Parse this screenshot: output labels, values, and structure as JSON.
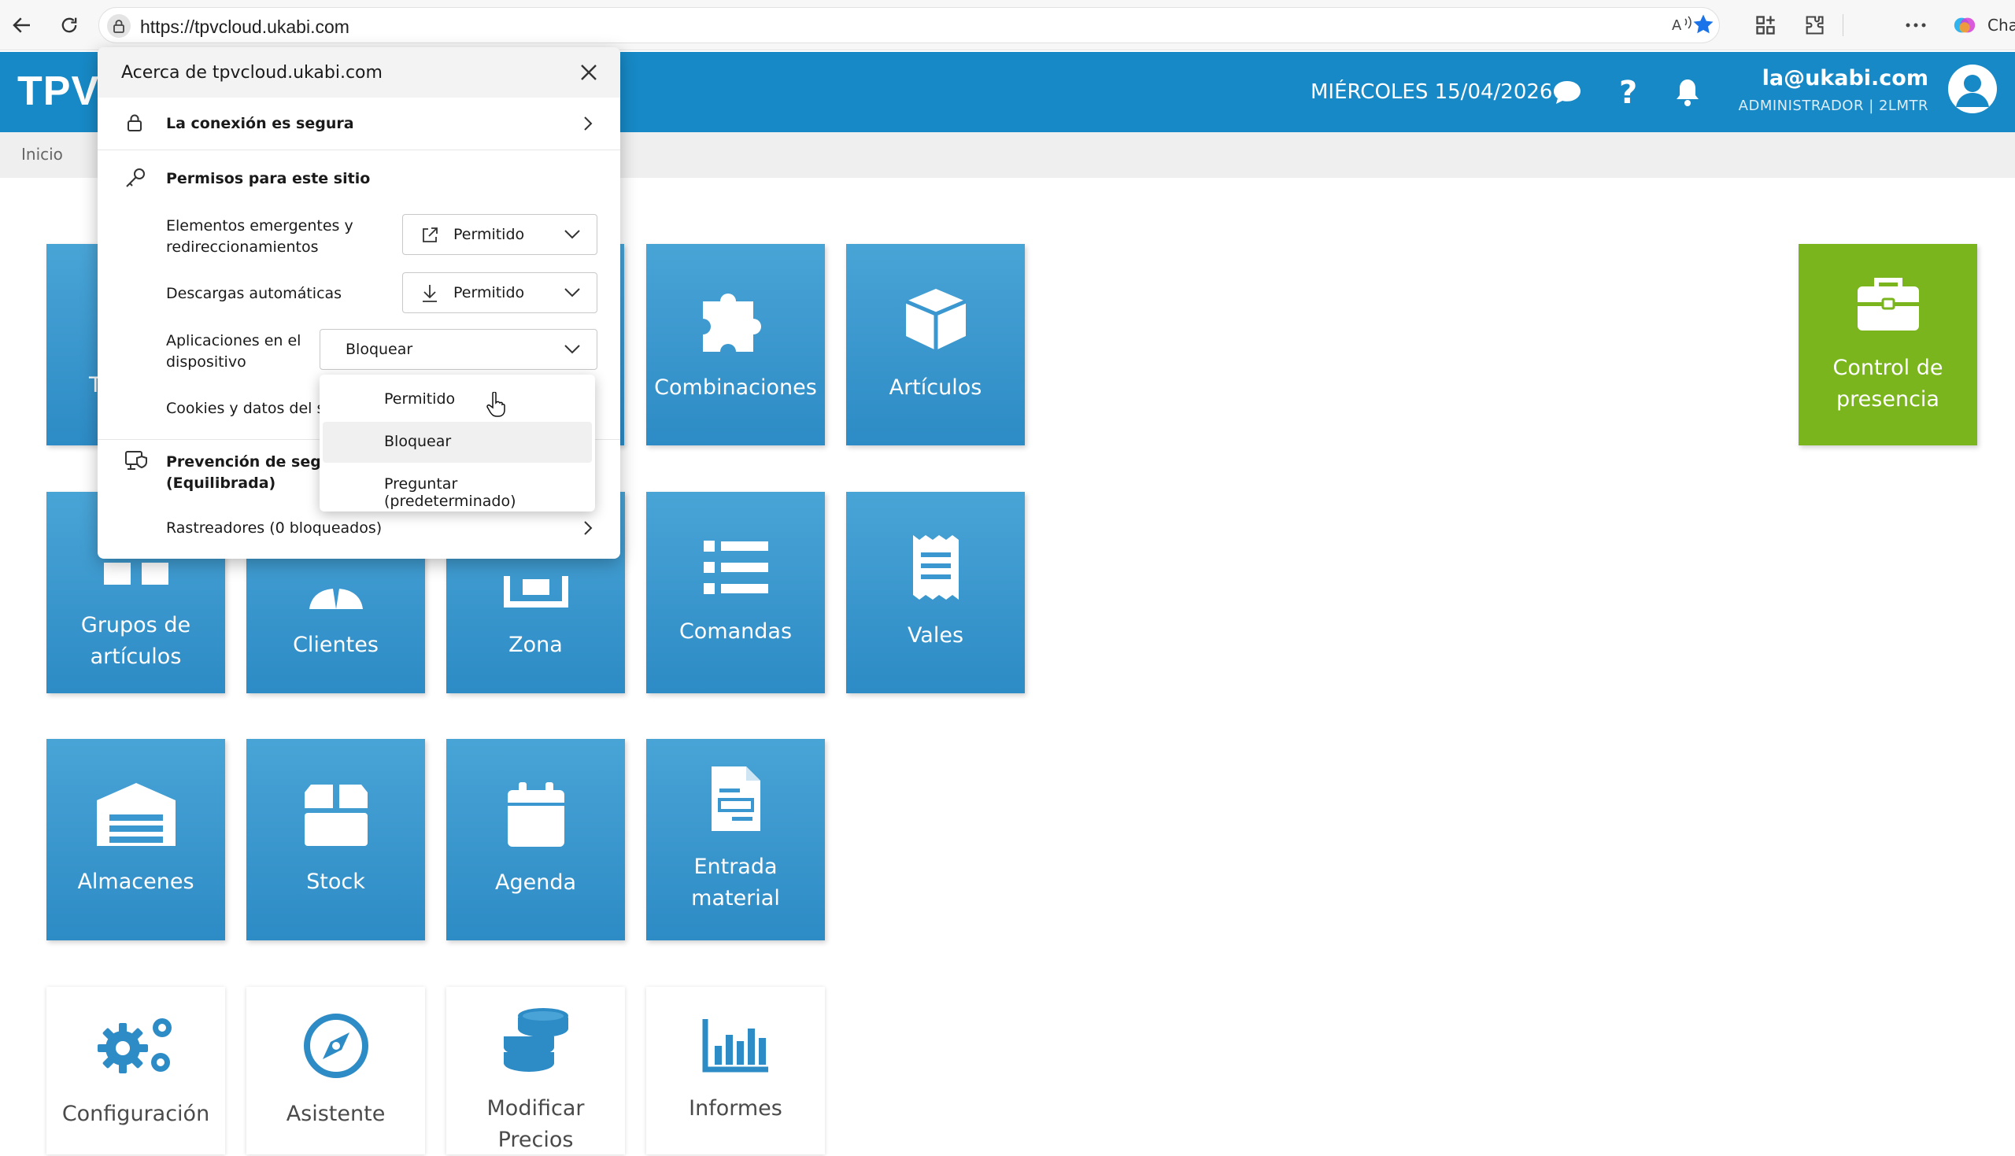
{
  "browser": {
    "url": "https://tpvcloud.ukabi.com",
    "copilot_label": "Cha"
  },
  "header": {
    "brand": "TPV",
    "date": "MIÉRCOLES 15/04/2026",
    "user_email": "la@ukabi.com",
    "user_role": "ADMINISTRADOR | 2LMTR"
  },
  "breadcrumb": "Inicio",
  "tiles": {
    "combinaciones": "Combinaciones",
    "articulos": "Artículos",
    "control_presencia": "Control de presencia",
    "grupos_articulos": "Grupos de artículos",
    "clientes": "Clientes",
    "zona": "Zona",
    "comandas": "Comandas",
    "vales": "Vales",
    "almacenes": "Almacenes",
    "stock": "Stock",
    "agenda": "Agenda",
    "entrada_material": "Entrada material",
    "configuracion": "Configuración",
    "asistente": "Asistente",
    "modificar_precios": "Modificar Precios",
    "informes": "Informes",
    "partial_tile_letter": "T"
  },
  "popup": {
    "title": "Acerca de tpvcloud.ukabi.com",
    "connection": "La conexión es segura",
    "permissions_heading": "Permisos para este sitio",
    "perm_popups_label": "Elementos emergentes y redireccionamientos",
    "perm_popups_value": "Permitido",
    "perm_downloads_label": "Descargas automáticas",
    "perm_downloads_value": "Permitido",
    "perm_apps_label": "Aplicaciones en el dispositivo",
    "perm_apps_value": "Bloquear",
    "cookies_label": "Cookies y datos del si",
    "tracking_label": "Prevención de seguin",
    "tracking_sub": "(Equilibrada)",
    "trackers": "Rastreadores (0 bloqueados)",
    "dropdown_options": [
      "Permitido",
      "Bloquear",
      "Preguntar (predeterminado)"
    ]
  },
  "colors": {
    "header_blue": "#1789c6",
    "tile_blue": "#3b97cf",
    "tile_green": "#7ab51d",
    "icon_blue": "#2d8bc5"
  }
}
